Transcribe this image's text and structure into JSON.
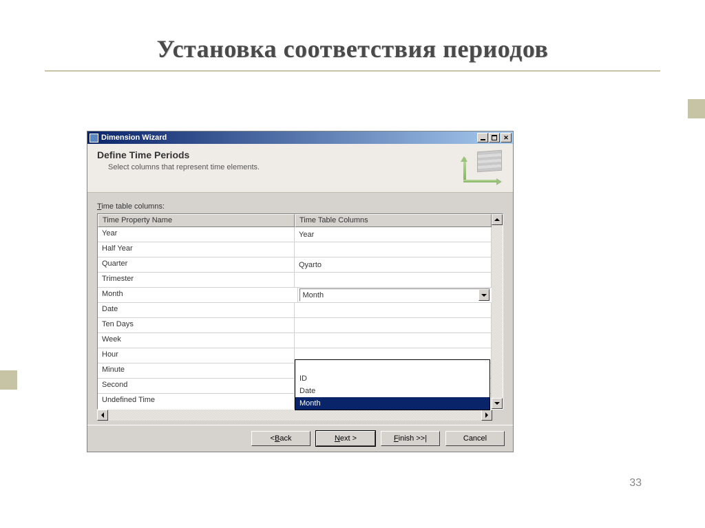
{
  "slide": {
    "title": "Установка соответствия периодов",
    "page_number": "33"
  },
  "window": {
    "title": "Dimension Wizard",
    "heading": "Define Time Periods",
    "sub": "Select columns that represent time elements.",
    "columns_label_pre": "T",
    "columns_label_post": "ime table columns:",
    "grid": {
      "headers": {
        "left": "Time Property Name",
        "right": "Time Table Columns"
      },
      "rows": [
        {
          "name": "Year",
          "value": "Year"
        },
        {
          "name": "Half Year",
          "value": ""
        },
        {
          "name": "Quarter",
          "value": "Qyarto"
        },
        {
          "name": "Trimester",
          "value": ""
        },
        {
          "name": "Month",
          "value": "Month",
          "combo": true
        },
        {
          "name": "Date",
          "value": ""
        },
        {
          "name": "Ten Days",
          "value": ""
        },
        {
          "name": "Week",
          "value": ""
        },
        {
          "name": "Hour",
          "value": ""
        },
        {
          "name": "Minute",
          "value": ""
        },
        {
          "name": "Second",
          "value": ""
        },
        {
          "name": "Undefined Time",
          "value": ""
        }
      ]
    },
    "dropdown": {
      "options": [
        "",
        "ID",
        "Date",
        "Month"
      ],
      "selected": "Month"
    },
    "buttons": {
      "back_pre": "< ",
      "back_u": "B",
      "back_post": "ack",
      "next_u": "N",
      "next_post": "ext >",
      "finish_u": "F",
      "finish_post": "inish >>|",
      "cancel": "Cancel"
    }
  }
}
